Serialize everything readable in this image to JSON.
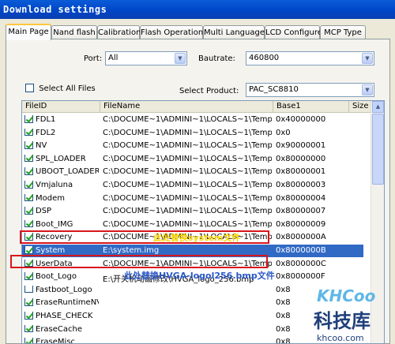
{
  "window": {
    "title": "Download settings"
  },
  "tabs": [
    {
      "label": "Main Page",
      "active": true
    },
    {
      "label": "Nand flash"
    },
    {
      "label": "Calibration"
    },
    {
      "label": "Flash Operations"
    },
    {
      "label": "Multi Languages"
    },
    {
      "label": "LCD Configure"
    },
    {
      "label": "MCP Type"
    }
  ],
  "port": {
    "label": "Port:",
    "value": "All"
  },
  "baudrate": {
    "label": "Bautrate:",
    "value": "460800"
  },
  "select_all": {
    "label": "Select All Files",
    "checked": false
  },
  "product": {
    "label": "Select Product:",
    "value": "PAC_SC8810"
  },
  "table": {
    "columns": [
      "FileID",
      "FileName",
      "Base1",
      "Size"
    ],
    "rows": [
      {
        "id": "FDL1",
        "file": "C:\\DOCUME~1\\ADMINI~1\\LOCALS~1\\Temp\\...",
        "base": "0x40000000",
        "checked": true
      },
      {
        "id": "FDL2",
        "file": "C:\\DOCUME~1\\ADMINI~1\\LOCALS~1\\Temp\\...",
        "base": "0x0",
        "checked": true
      },
      {
        "id": "NV",
        "file": "C:\\DOCUME~1\\ADMINI~1\\LOCALS~1\\Temp\\...",
        "base": "0x90000001",
        "checked": true
      },
      {
        "id": "SPL_LOADER",
        "file": "C:\\DOCUME~1\\ADMINI~1\\LOCALS~1\\Temp\\...",
        "base": "0x80000000",
        "checked": true
      },
      {
        "id": "UBOOT_LOADER",
        "file": "C:\\DOCUME~1\\ADMINI~1\\LOCALS~1\\Temp\\...",
        "base": "0x80000001",
        "checked": true
      },
      {
        "id": "Vmjaluna",
        "file": "C:\\DOCUME~1\\ADMINI~1\\LOCALS~1\\Temp\\...",
        "base": "0x80000003",
        "checked": true
      },
      {
        "id": "Modem",
        "file": "C:\\DOCUME~1\\ADMINI~1\\LOCALS~1\\Temp\\...",
        "base": "0x80000004",
        "checked": true
      },
      {
        "id": "DSP",
        "file": "C:\\DOCUME~1\\ADMINI~1\\LOCALS~1\\Temp\\...",
        "base": "0x80000007",
        "checked": true
      },
      {
        "id": "Boot_IMG",
        "file": "C:\\DOCUME~1\\ADMINI~1\\LOCALS~1\\Temp\\...",
        "base": "0x80000009",
        "checked": true
      },
      {
        "id": "Recovery",
        "file": "C:\\DOCUME~1\\ADMINI~1\\LOCALS~1\\Temp\\...",
        "base": "0x8000000A",
        "checked": true
      },
      {
        "id": "System",
        "file": "E:\\system.img",
        "base": "0x8000000B",
        "checked": true,
        "selected": true
      },
      {
        "id": "UserData",
        "file": "C:\\DOCUME~1\\ADMINI~1\\LOCALS~1\\Temp\\...",
        "base": "0x8000000C",
        "checked": true
      },
      {
        "id": "Boot_Logo",
        "file": "E:\\开关机动画修改\\HVGA_logo_256.bmp",
        "base": "0x8000000F",
        "checked": true
      },
      {
        "id": "Fastboot_Logo",
        "file": "",
        "base": "0x8",
        "checked": false
      },
      {
        "id": "EraseRuntimeNV",
        "file": "",
        "base": "0x8",
        "checked": true
      },
      {
        "id": "PHASE_CHECK",
        "file": "",
        "base": "0x8",
        "checked": true
      },
      {
        "id": "EraseCache",
        "file": "",
        "base": "0x8",
        "checked": true
      },
      {
        "id": "EraseMisc",
        "file": "",
        "base": "0x8",
        "checked": true
      }
    ]
  },
  "annotations": {
    "system": "此处替换system文件",
    "logo": "此处替换HVGA-logol256.bmp文件",
    "color_system": "#ffd800",
    "color_logo": "#2a57c8",
    "box_color": "#d8161c"
  },
  "watermark": {
    "brand": "KHCoo",
    "cn": "科技库",
    "url": "khcoo.com"
  },
  "icons": {
    "dropdown": "chevron-down-icon",
    "checkbox": "check-icon"
  }
}
